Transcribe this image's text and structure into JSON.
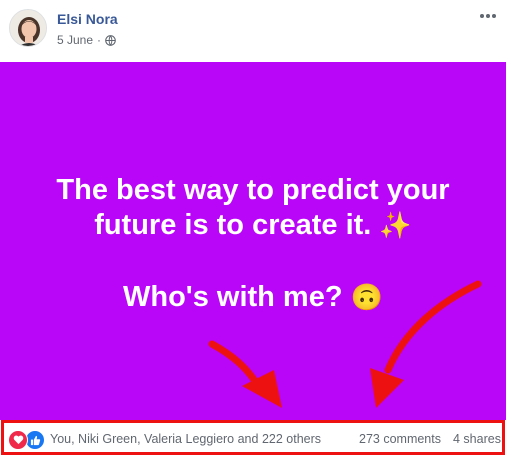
{
  "post": {
    "author": "Elsi Nora",
    "date": "5 June",
    "privacy_icon": "globe-icon",
    "more_icon": "more-options-icon",
    "text_line1": "The best way to predict your",
    "text_line2": "future is to create it.",
    "emoji1": "✨",
    "text_line3": "Who's with me?",
    "emoji2": "🙃",
    "background_color": "#b905f8"
  },
  "footer": {
    "reactions": [
      "love",
      "like"
    ],
    "names": "You, Niki Green, Valeria Leggiero and 222 others",
    "comments": "273 comments",
    "shares": "4 shares",
    "highlight_color": "#ee1111"
  }
}
